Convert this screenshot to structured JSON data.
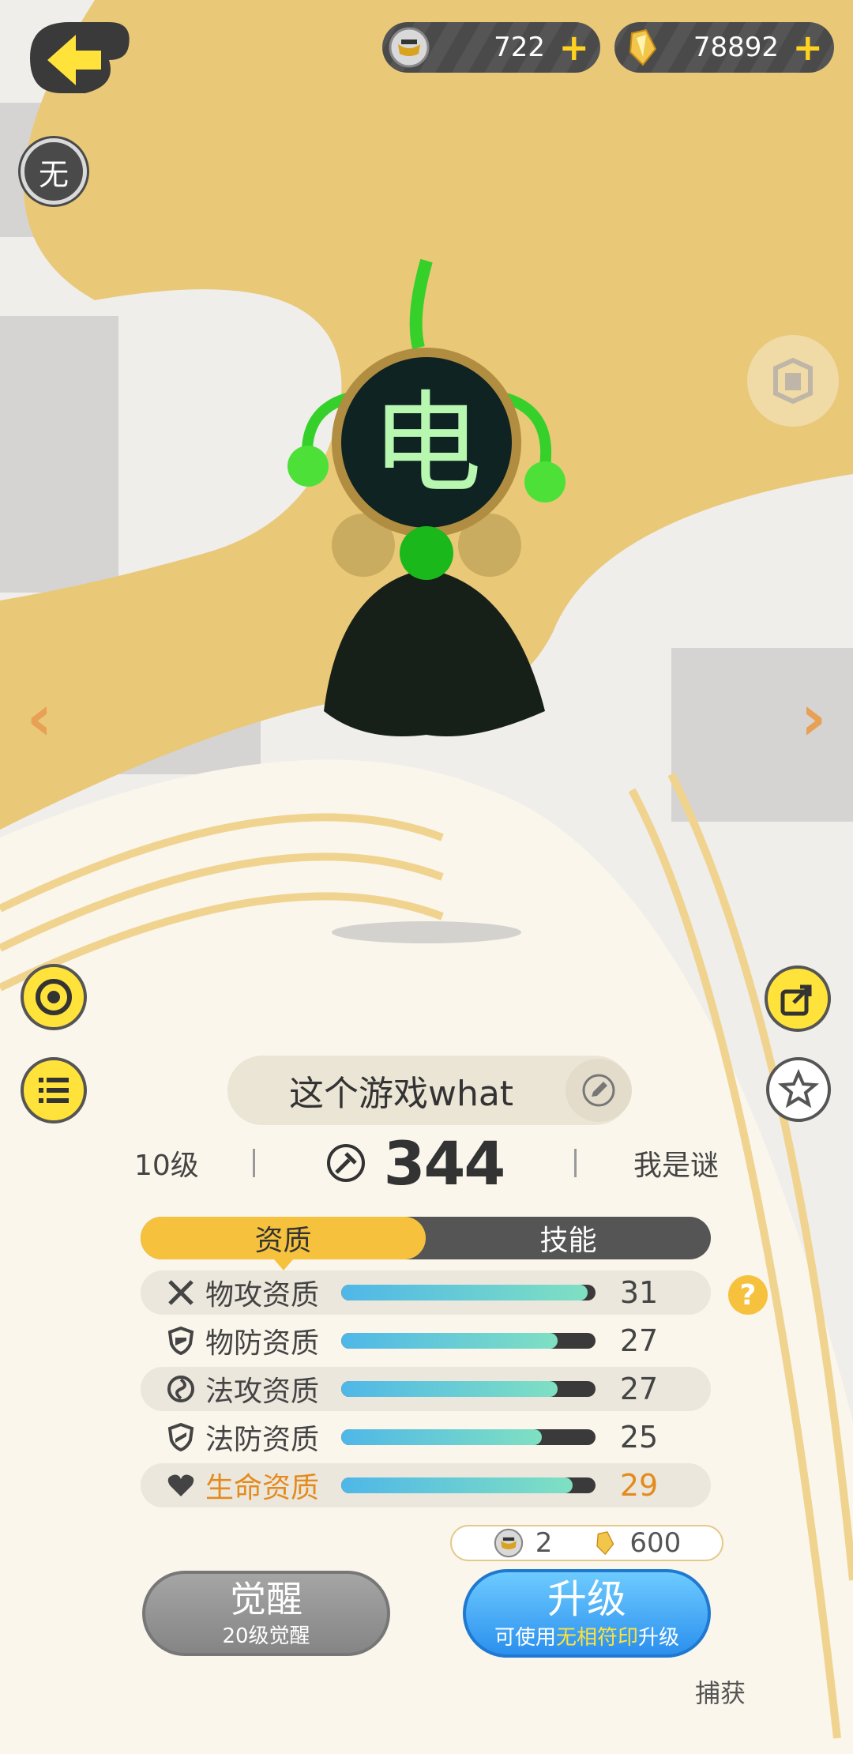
{
  "currencies": {
    "coins": "722",
    "crystals": "78892"
  },
  "lock_badge": "无",
  "pet": {
    "name": "这个游戏what",
    "level": "10级",
    "power": "344",
    "title": "我是谜"
  },
  "tabs": [
    {
      "label": "资质",
      "active": true
    },
    {
      "label": "技能",
      "active": false
    }
  ],
  "attributes": [
    {
      "label": "物攻资质",
      "value": "31",
      "fill": 0.97,
      "icon": "crossed-swords-icon"
    },
    {
      "label": "物防资质",
      "value": "27",
      "fill": 0.85,
      "icon": "shield-icon"
    },
    {
      "label": "法攻资质",
      "value": "27",
      "fill": 0.85,
      "icon": "magic-swirl-icon"
    },
    {
      "label": "法防资质",
      "value": "25",
      "fill": 0.79,
      "icon": "magic-shield-icon"
    },
    {
      "label": "生命资质",
      "value": "29",
      "fill": 0.91,
      "icon": "heart-icon"
    }
  ],
  "help_label": "?",
  "cost": {
    "coins": "2",
    "crystals": "600"
  },
  "buttons": {
    "awaken_main": "觉醒",
    "awaken_sub": "20级觉醒",
    "upgrade_main": "升级",
    "upgrade_sub_prefix": "可使用",
    "upgrade_sub_highlight": "无相符印",
    "upgrade_sub_suffix": "升级",
    "capture": "捕获"
  },
  "colors": {
    "accent_yellow": "#f6c23e",
    "hp_orange": "#e38b1d",
    "upgrade_blue": "#2b90ee"
  }
}
